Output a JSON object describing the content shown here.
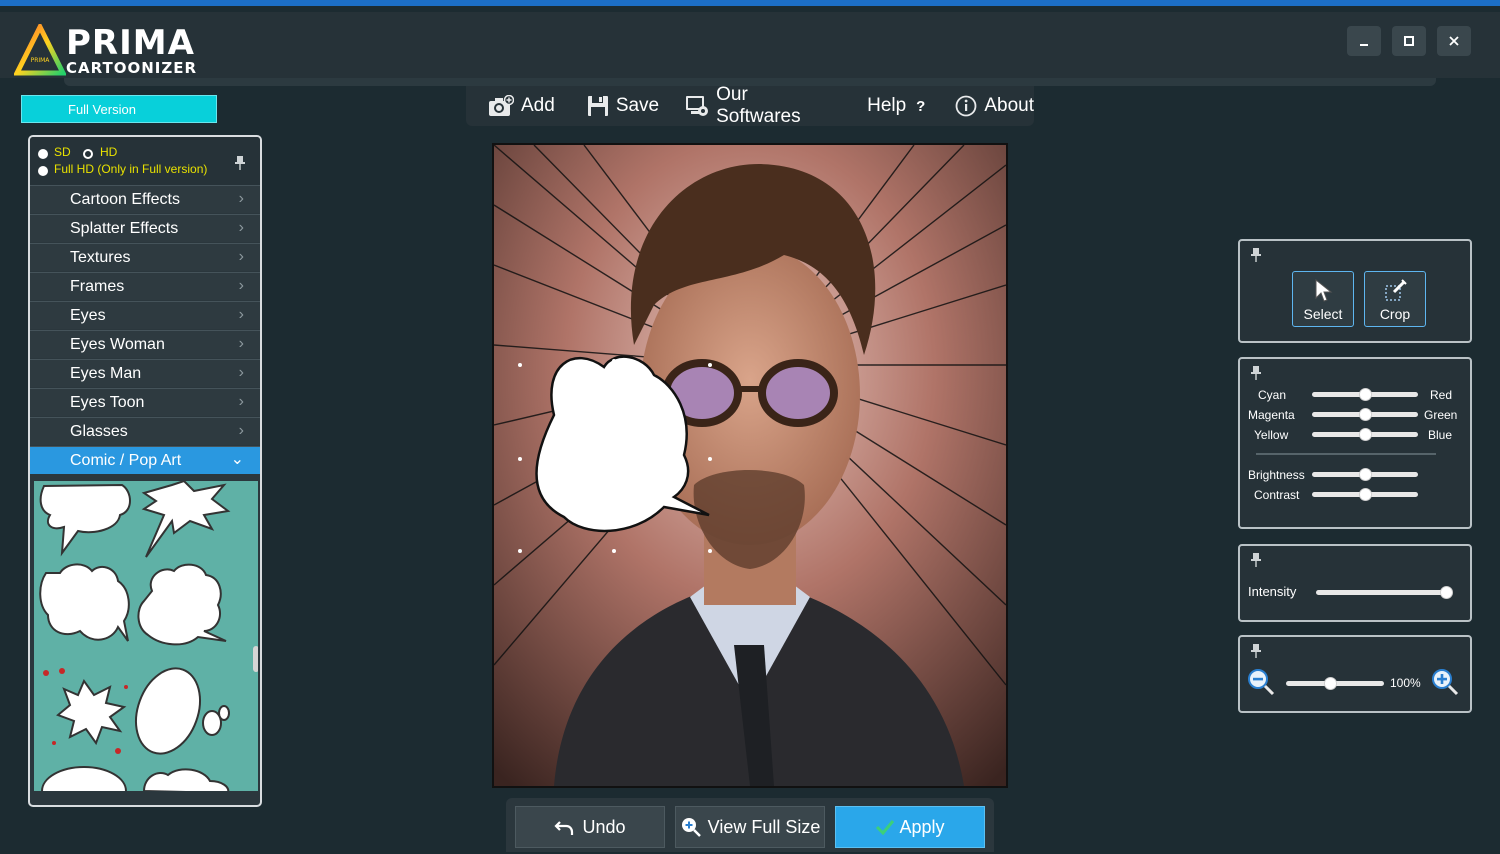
{
  "app": {
    "logo_title": "PRIMA",
    "logo_subtitle": "CARTOONIZER",
    "logo_badge": "PRIMA",
    "window_controls": [
      "minimize",
      "maximize",
      "close"
    ]
  },
  "full_version_label": "Full Version",
  "toolbar": {
    "items": [
      {
        "label": "Add",
        "icon": "camera-add-icon"
      },
      {
        "label": "Save",
        "icon": "floppy-disk-icon"
      },
      {
        "label": "Our Softwares",
        "icon": "software-icon"
      },
      {
        "label": "Help",
        "icon": "question-icon"
      },
      {
        "label": "About",
        "icon": "info-icon"
      }
    ]
  },
  "resolution": {
    "sd": "SD",
    "hd": "HD",
    "full_hd": "Full HD (Only in Full version)",
    "selected": "HD"
  },
  "menu": {
    "items": [
      {
        "label": "Cartoon Effects"
      },
      {
        "label": "Splatter Effects"
      },
      {
        "label": "Textures"
      },
      {
        "label": "Frames"
      },
      {
        "label": "Eyes"
      },
      {
        "label": "Eyes Woman"
      },
      {
        "label": "Eyes Man"
      },
      {
        "label": "Eyes Toon"
      },
      {
        "label": "Glasses"
      },
      {
        "label": "Comic / Pop Art"
      }
    ],
    "active": "Comic / Pop Art"
  },
  "tools": {
    "select_label": "Select",
    "crop_label": "Crop"
  },
  "color_balance": {
    "cyan": "Cyan",
    "red": "Red",
    "magenta": "Magenta",
    "green": "Green",
    "yellow": "Yellow",
    "blue": "Blue",
    "brightness": "Brightness",
    "contrast": "Contrast",
    "values": {
      "cyan_red": 0.5,
      "magenta_green": 0.5,
      "yellow_blue": 0.5,
      "brightness": 0.5,
      "contrast": 0.5
    }
  },
  "intensity": {
    "label": "Intensity",
    "value": 1.0
  },
  "zoom": {
    "value_label": "100%",
    "slider": 0.45
  },
  "bottom": {
    "undo": "Undo",
    "view_full_size": "View Full Size",
    "apply": "Apply"
  },
  "colors": {
    "accent_cyan": "#08d0da",
    "accent_blue": "#2a98e0",
    "titlebar_blue": "#1c6fc7",
    "resolution_yellow": "#e8e100"
  }
}
